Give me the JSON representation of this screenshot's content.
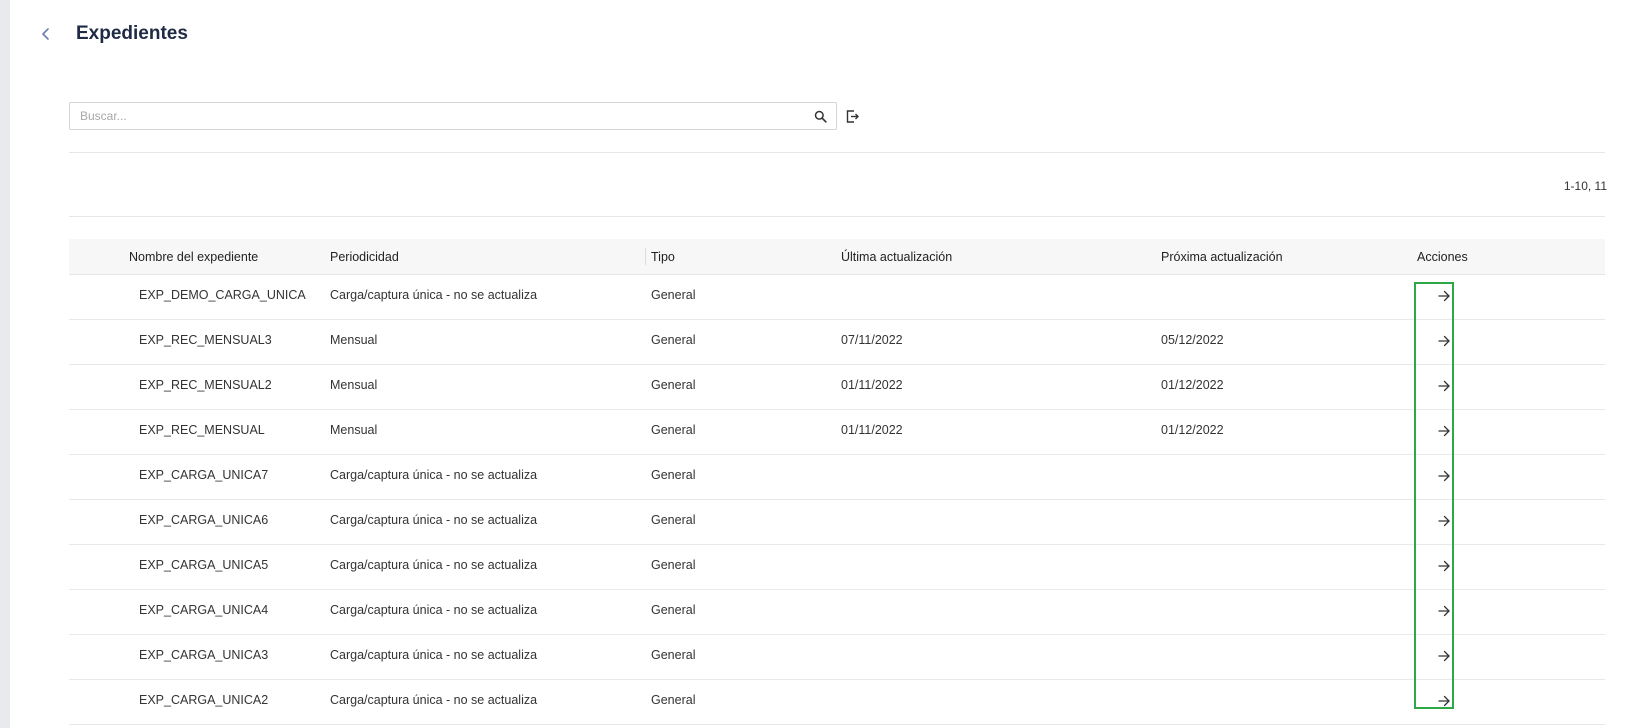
{
  "header": {
    "title": "Expedientes"
  },
  "search": {
    "placeholder": "Buscar...",
    "value": ""
  },
  "pagination": {
    "label": "1-10, 11"
  },
  "table": {
    "columns": [
      "Nombre del expediente",
      "Periodicidad",
      "Tipo",
      "Última actualización",
      "Próxima actualización",
      "Acciones"
    ],
    "rows": [
      {
        "name": "EXP_DEMO_CARGA_UNICA",
        "periodicity": "Carga/captura única - no se actualiza",
        "type": "General",
        "last": "",
        "next": ""
      },
      {
        "name": "EXP_REC_MENSUAL3",
        "periodicity": "Mensual",
        "type": "General",
        "last": "07/11/2022",
        "next": "05/12/2022"
      },
      {
        "name": "EXP_REC_MENSUAL2",
        "periodicity": "Mensual",
        "type": "General",
        "last": "01/11/2022",
        "next": "01/12/2022"
      },
      {
        "name": "EXP_REC_MENSUAL",
        "periodicity": "Mensual",
        "type": "General",
        "last": "01/11/2022",
        "next": "01/12/2022"
      },
      {
        "name": "EXP_CARGA_UNICA7",
        "periodicity": "Carga/captura única - no se actualiza",
        "type": "General",
        "last": "",
        "next": ""
      },
      {
        "name": "EXP_CARGA_UNICA6",
        "periodicity": "Carga/captura única - no se actualiza",
        "type": "General",
        "last": "",
        "next": ""
      },
      {
        "name": "EXP_CARGA_UNICA5",
        "periodicity": "Carga/captura única - no se actualiza",
        "type": "General",
        "last": "",
        "next": ""
      },
      {
        "name": "EXP_CARGA_UNICA4",
        "periodicity": "Carga/captura única - no se actualiza",
        "type": "General",
        "last": "",
        "next": ""
      },
      {
        "name": "EXP_CARGA_UNICA3",
        "periodicity": "Carga/captura única - no se actualiza",
        "type": "General",
        "last": "",
        "next": ""
      },
      {
        "name": "EXP_CARGA_UNICA2",
        "periodicity": "Carga/captura única - no se actualiza",
        "type": "General",
        "last": "",
        "next": ""
      }
    ]
  },
  "icons": {
    "back": "chevron-left-icon",
    "search": "search-icon",
    "export": "export-icon",
    "row_action": "arrow-right-icon"
  },
  "colors": {
    "highlight": "#2ea846",
    "title": "#1f2a44",
    "header_bg": "#f7f7f8"
  }
}
